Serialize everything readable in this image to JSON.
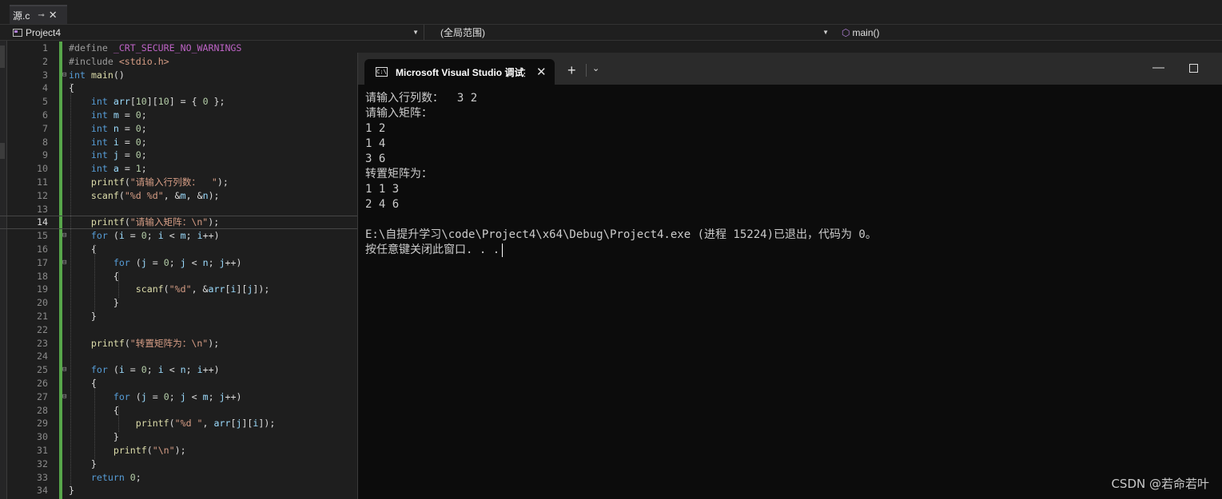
{
  "tab": {
    "filename": "源.c",
    "pin_glyph": "⊸",
    "close_glyph": "✕"
  },
  "nav": {
    "project": "Project4",
    "scope": "(全局范围)",
    "function": "main()"
  },
  "code": {
    "line_numbers": [
      "1",
      "2",
      "3",
      "4",
      "5",
      "6",
      "7",
      "8",
      "9",
      "10",
      "11",
      "12",
      "13",
      "14",
      "15",
      "16",
      "17",
      "18",
      "19",
      "20",
      "21",
      "22",
      "23",
      "24",
      "25",
      "26",
      "27",
      "28",
      "29",
      "30",
      "31",
      "32",
      "33",
      "34"
    ],
    "current_line": 14,
    "tokens": [
      [
        [
          "pp",
          "#define "
        ],
        [
          "mac",
          "_CRT_SECURE_NO_WARNINGS"
        ]
      ],
      [
        [
          "pp",
          "#include "
        ],
        [
          "str",
          "<stdio.h>"
        ]
      ],
      [
        [
          "kw",
          "int"
        ],
        [
          "t",
          " "
        ],
        [
          "fn",
          "main"
        ],
        [
          "t",
          "()"
        ]
      ],
      [
        [
          "t",
          "{"
        ]
      ],
      [
        [
          "t",
          "    "
        ],
        [
          "kw",
          "int"
        ],
        [
          "t",
          " "
        ],
        [
          "var",
          "arr"
        ],
        [
          "t",
          "["
        ],
        [
          "num",
          "10"
        ],
        [
          "t",
          "]["
        ],
        [
          "num",
          "10"
        ],
        [
          "t",
          "] = { "
        ],
        [
          "num",
          "0"
        ],
        [
          "t",
          " };"
        ]
      ],
      [
        [
          "t",
          "    "
        ],
        [
          "kw",
          "int"
        ],
        [
          "t",
          " "
        ],
        [
          "var",
          "m"
        ],
        [
          "t",
          " = "
        ],
        [
          "num",
          "0"
        ],
        [
          "t",
          ";"
        ]
      ],
      [
        [
          "t",
          "    "
        ],
        [
          "kw",
          "int"
        ],
        [
          "t",
          " "
        ],
        [
          "var",
          "n"
        ],
        [
          "t",
          " = "
        ],
        [
          "num",
          "0"
        ],
        [
          "t",
          ";"
        ]
      ],
      [
        [
          "t",
          "    "
        ],
        [
          "kw",
          "int"
        ],
        [
          "t",
          " "
        ],
        [
          "var",
          "i"
        ],
        [
          "t",
          " = "
        ],
        [
          "num",
          "0"
        ],
        [
          "t",
          ";"
        ]
      ],
      [
        [
          "t",
          "    "
        ],
        [
          "kw",
          "int"
        ],
        [
          "t",
          " "
        ],
        [
          "var",
          "j"
        ],
        [
          "t",
          " = "
        ],
        [
          "num",
          "0"
        ],
        [
          "t",
          ";"
        ]
      ],
      [
        [
          "t",
          "    "
        ],
        [
          "kw",
          "int"
        ],
        [
          "t",
          " "
        ],
        [
          "var",
          "a"
        ],
        [
          "t",
          " = "
        ],
        [
          "num",
          "1"
        ],
        [
          "t",
          ";"
        ]
      ],
      [
        [
          "t",
          "    "
        ],
        [
          "fn",
          "printf"
        ],
        [
          "t",
          "("
        ],
        [
          "str",
          "\"请输入行列数：  \""
        ],
        [
          "t",
          ");"
        ]
      ],
      [
        [
          "t",
          "    "
        ],
        [
          "fn",
          "scanf"
        ],
        [
          "t",
          "("
        ],
        [
          "str",
          "\"%d %d\""
        ],
        [
          "t",
          ", &"
        ],
        [
          "var",
          "m"
        ],
        [
          "t",
          ", &"
        ],
        [
          "var",
          "n"
        ],
        [
          "t",
          ");"
        ]
      ],
      [],
      [
        [
          "t",
          "    "
        ],
        [
          "fn",
          "printf"
        ],
        [
          "t",
          "("
        ],
        [
          "str",
          "\"请输入矩阵：\\n\""
        ],
        [
          "t",
          ");"
        ]
      ],
      [
        [
          "t",
          "    "
        ],
        [
          "kw",
          "for"
        ],
        [
          "t",
          " ("
        ],
        [
          "var",
          "i"
        ],
        [
          "t",
          " = "
        ],
        [
          "num",
          "0"
        ],
        [
          "t",
          "; "
        ],
        [
          "var",
          "i"
        ],
        [
          "t",
          " < "
        ],
        [
          "var",
          "m"
        ],
        [
          "t",
          "; "
        ],
        [
          "var",
          "i"
        ],
        [
          "t",
          "++)"
        ]
      ],
      [
        [
          "t",
          "    {"
        ]
      ],
      [
        [
          "t",
          "        "
        ],
        [
          "kw",
          "for"
        ],
        [
          "t",
          " ("
        ],
        [
          "var",
          "j"
        ],
        [
          "t",
          " = "
        ],
        [
          "num",
          "0"
        ],
        [
          "t",
          "; "
        ],
        [
          "var",
          "j"
        ],
        [
          "t",
          " < "
        ],
        [
          "var",
          "n"
        ],
        [
          "t",
          "; "
        ],
        [
          "var",
          "j"
        ],
        [
          "t",
          "++)"
        ]
      ],
      [
        [
          "t",
          "        {"
        ]
      ],
      [
        [
          "t",
          "            "
        ],
        [
          "fn",
          "scanf"
        ],
        [
          "t",
          "("
        ],
        [
          "str",
          "\"%d\""
        ],
        [
          "t",
          ", &"
        ],
        [
          "var",
          "arr"
        ],
        [
          "t",
          "["
        ],
        [
          "var",
          "i"
        ],
        [
          "t",
          "]["
        ],
        [
          "var",
          "j"
        ],
        [
          "t",
          "]);"
        ]
      ],
      [
        [
          "t",
          "        }"
        ]
      ],
      [
        [
          "t",
          "    }"
        ]
      ],
      [],
      [
        [
          "t",
          "    "
        ],
        [
          "fn",
          "printf"
        ],
        [
          "t",
          "("
        ],
        [
          "str",
          "\"转置矩阵为：\\n\""
        ],
        [
          "t",
          ");"
        ]
      ],
      [],
      [
        [
          "t",
          "    "
        ],
        [
          "kw",
          "for"
        ],
        [
          "t",
          " ("
        ],
        [
          "var",
          "i"
        ],
        [
          "t",
          " = "
        ],
        [
          "num",
          "0"
        ],
        [
          "t",
          "; "
        ],
        [
          "var",
          "i"
        ],
        [
          "t",
          " < "
        ],
        [
          "var",
          "n"
        ],
        [
          "t",
          "; "
        ],
        [
          "var",
          "i"
        ],
        [
          "t",
          "++)"
        ]
      ],
      [
        [
          "t",
          "    {"
        ]
      ],
      [
        [
          "t",
          "        "
        ],
        [
          "kw",
          "for"
        ],
        [
          "t",
          " ("
        ],
        [
          "var",
          "j"
        ],
        [
          "t",
          " = "
        ],
        [
          "num",
          "0"
        ],
        [
          "t",
          "; "
        ],
        [
          "var",
          "j"
        ],
        [
          "t",
          " < "
        ],
        [
          "var",
          "m"
        ],
        [
          "t",
          "; "
        ],
        [
          "var",
          "j"
        ],
        [
          "t",
          "++)"
        ]
      ],
      [
        [
          "t",
          "        {"
        ]
      ],
      [
        [
          "t",
          "            "
        ],
        [
          "fn",
          "printf"
        ],
        [
          "t",
          "("
        ],
        [
          "str",
          "\"%d \""
        ],
        [
          "t",
          ", "
        ],
        [
          "var",
          "arr"
        ],
        [
          "t",
          "["
        ],
        [
          "var",
          "j"
        ],
        [
          "t",
          "]["
        ],
        [
          "var",
          "i"
        ],
        [
          "t",
          "]);"
        ]
      ],
      [
        [
          "t",
          "        }"
        ]
      ],
      [
        [
          "t",
          "        "
        ],
        [
          "fn",
          "printf"
        ],
        [
          "t",
          "("
        ],
        [
          "str",
          "\"\\n\""
        ],
        [
          "t",
          ");"
        ]
      ],
      [
        [
          "t",
          "    }"
        ]
      ],
      [
        [
          "t",
          "    "
        ],
        [
          "kw",
          "return"
        ],
        [
          "t",
          " "
        ],
        [
          "num",
          "0"
        ],
        [
          "t",
          ";"
        ]
      ],
      [
        [
          "t",
          "}"
        ]
      ]
    ],
    "fold_markers": {
      "3": "⊟",
      "15": "⊟",
      "17": "⊟",
      "25": "⊟",
      "27": "⊟"
    }
  },
  "terminal": {
    "tab_title": "Microsoft Visual Studio 调试控",
    "cmd_icon_text": "C:\\",
    "tab_close": "✕",
    "new_tab": "+",
    "dropdown": "⌄",
    "minimize": "—",
    "close_window": "✕",
    "lines": [
      "请输入行列数：  3 2",
      "请输入矩阵：",
      "1 2",
      "1 4",
      "3 6",
      "转置矩阵为：",
      "1 1 3",
      "2 4 6",
      "",
      "E:\\自提升学习\\code\\Project4\\x64\\Debug\\Project4.exe (进程 15224)已退出，代码为 0。",
      "按任意键关闭此窗口. . ."
    ]
  },
  "watermark": "CSDN @若命若叶",
  "colors": {
    "keyword": "#569cd6",
    "string": "#d69d85",
    "change_bar": "#57a64a",
    "terminal_bg": "#0c0c0c"
  }
}
